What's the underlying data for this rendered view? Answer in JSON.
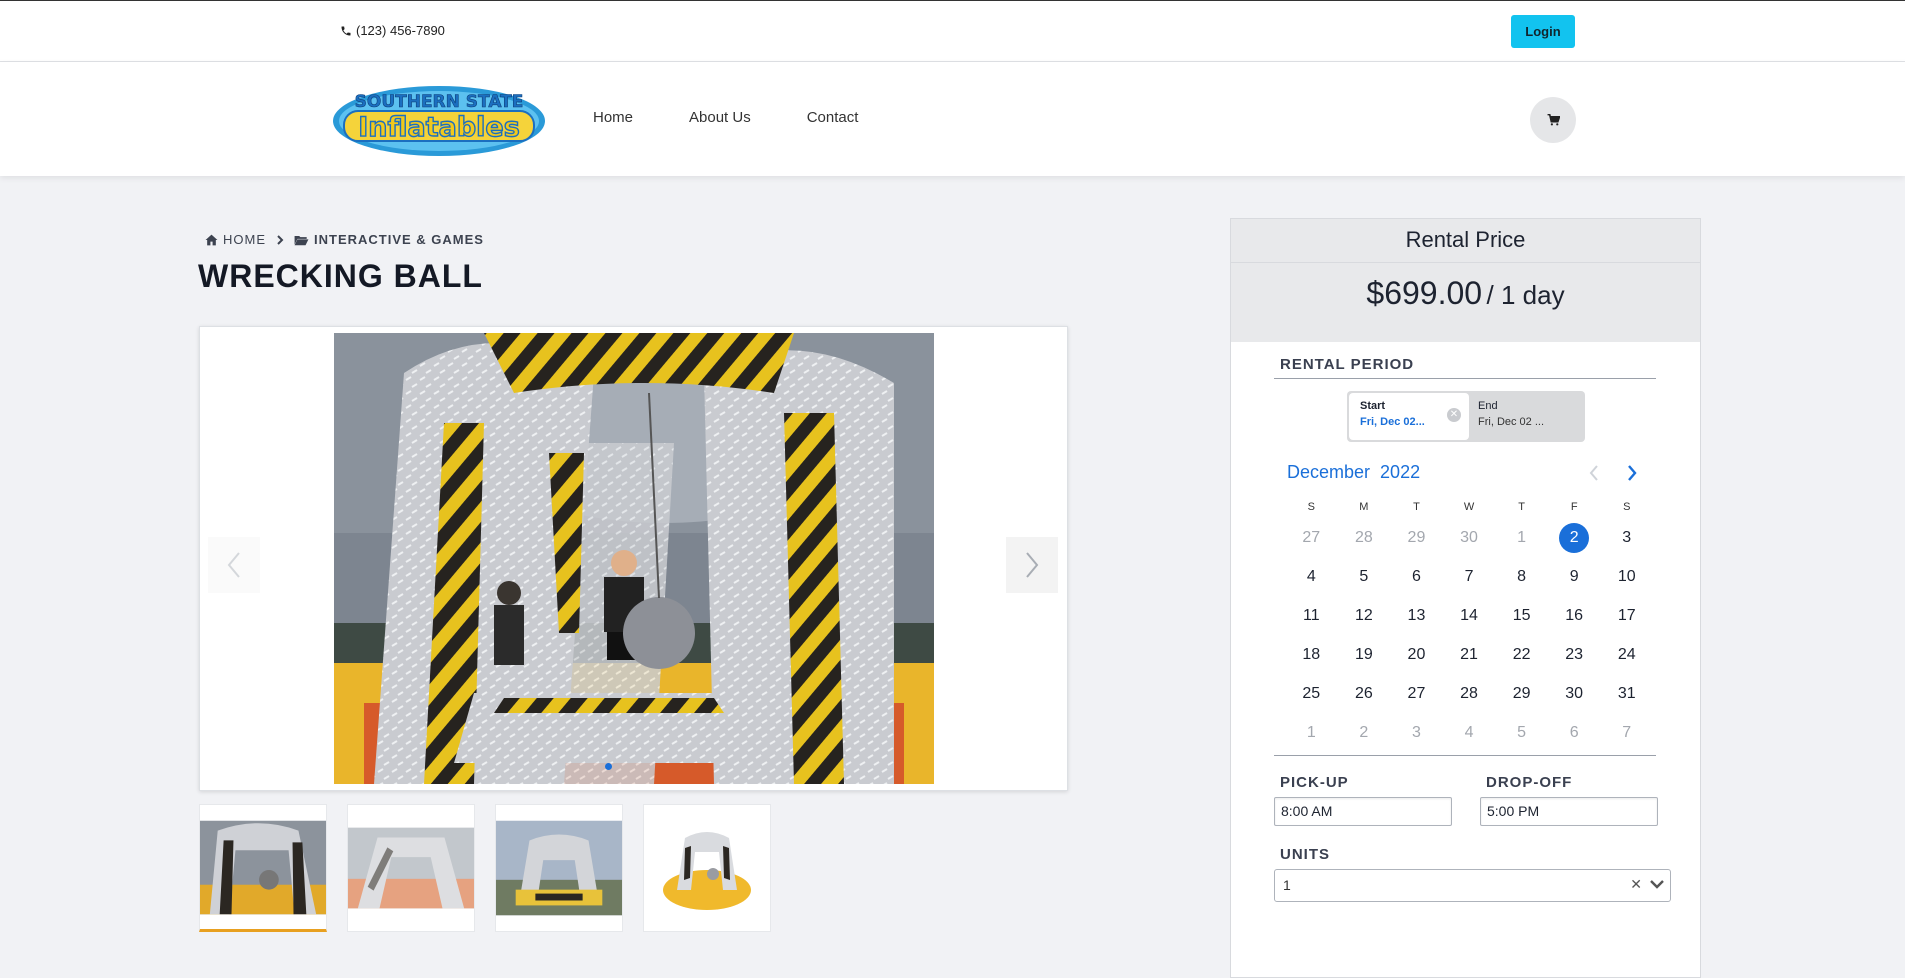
{
  "topbar": {
    "phone": "(123) 456-7890",
    "login_label": "Login"
  },
  "brand": {
    "logo_line1": "SOUTHERN STATE",
    "logo_line2": "Inflatables"
  },
  "nav": {
    "items": [
      "Home",
      "About Us",
      "Contact"
    ]
  },
  "breadcrumb": {
    "home": "HOME",
    "category": "INTERACTIVE & GAMES"
  },
  "product": {
    "title": "WRECKING BALL"
  },
  "gallery": {
    "image_count": 4,
    "active_index": 0
  },
  "rental": {
    "header": "Rental Price",
    "price": "$699.00",
    "per": "/ 1 day",
    "period_label": "RENTAL PERIOD",
    "start_title": "Start",
    "start_value": "Fri, Dec 02...",
    "end_title": "End",
    "end_value": "Fri, Dec 02 ...",
    "calendar": {
      "month": "December",
      "year": "2022",
      "dow": [
        "S",
        "M",
        "T",
        "W",
        "T",
        "F",
        "S"
      ],
      "weeks": [
        [
          "27",
          "28",
          "29",
          "30",
          "1",
          "2",
          "3"
        ],
        [
          "4",
          "5",
          "6",
          "7",
          "8",
          "9",
          "10"
        ],
        [
          "11",
          "12",
          "13",
          "14",
          "15",
          "16",
          "17"
        ],
        [
          "18",
          "19",
          "20",
          "21",
          "22",
          "23",
          "24"
        ],
        [
          "25",
          "26",
          "27",
          "28",
          "29",
          "30",
          "31"
        ],
        [
          "1",
          "2",
          "3",
          "4",
          "5",
          "6",
          "7"
        ]
      ],
      "selected": "2"
    },
    "pickup_label": "PICK-UP",
    "pickup_value": "8:00 AM",
    "dropoff_label": "DROP-OFF",
    "dropoff_value": "5:00 PM",
    "units_label": "UNITS",
    "units_value": "1"
  },
  "colors": {
    "accent": "#1a6fd9",
    "login": "#12c3ef"
  }
}
